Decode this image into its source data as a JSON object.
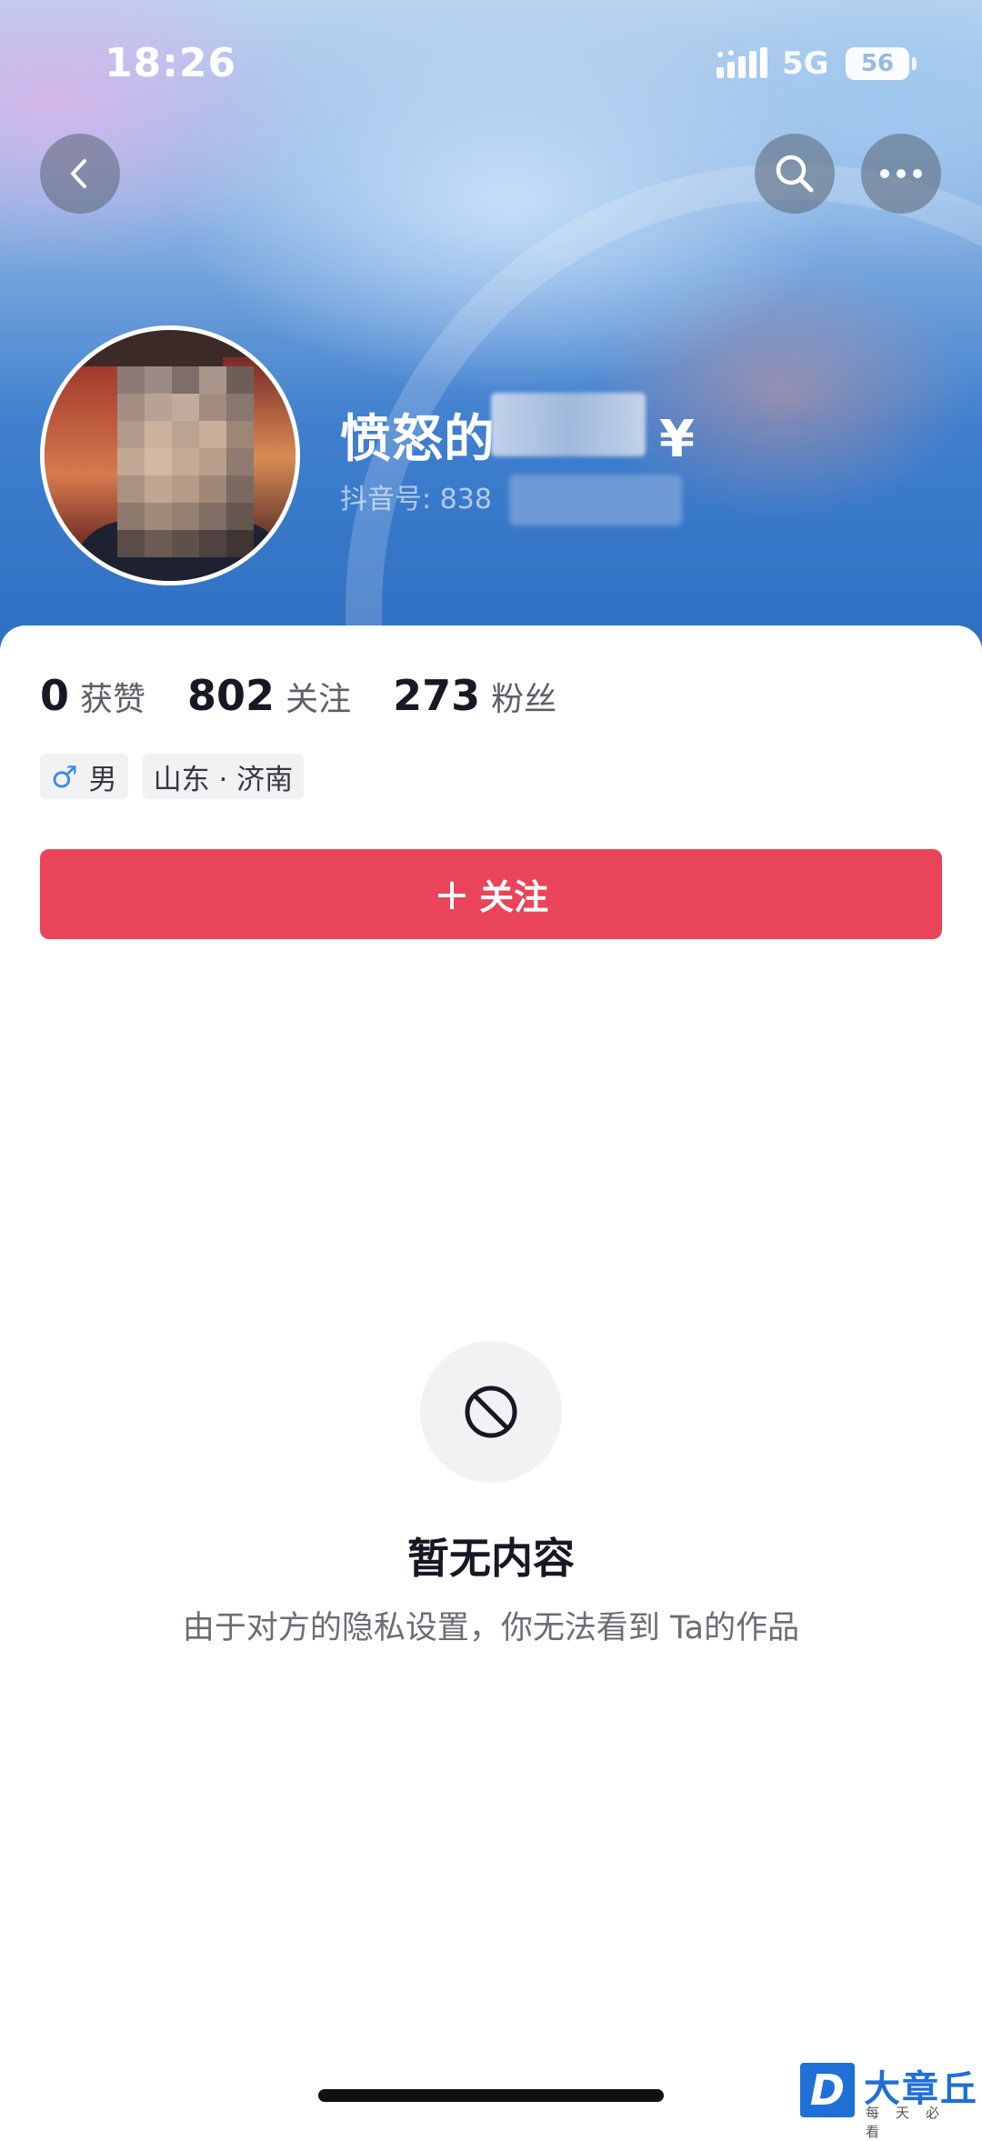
{
  "status_bar": {
    "time": "18:26",
    "network": "5G",
    "battery": "56"
  },
  "nav": {
    "back_icon": "chevron-left-icon",
    "search_icon": "search-icon",
    "more_icon": "more-dots-icon"
  },
  "profile": {
    "name": "愤怒的",
    "name_suffix": "¥",
    "douyin_id_label": "抖音号: 838",
    "avatar": "blurred-avatar"
  },
  "stats": [
    {
      "value": "0",
      "label": "获赞"
    },
    {
      "value": "802",
      "label": "关注"
    },
    {
      "value": "273",
      "label": "粉丝"
    }
  ],
  "tags": {
    "gender_symbol": "♂",
    "gender": "男",
    "location": "山东 · 济南"
  },
  "follow_button": {
    "plus": "+",
    "label": "关注"
  },
  "empty_state": {
    "icon": "no-entry-icon",
    "title": "暂无内容",
    "description": "由于对方的隐私设置，你无法看到 Ta的作品"
  },
  "watermark": {
    "logo": "D",
    "name": "大章丘",
    "slogan": "每天必看"
  },
  "colors": {
    "accent": "#ea445a",
    "header_blue": "#2f6fc2",
    "gender_blue": "#3c8be8"
  }
}
